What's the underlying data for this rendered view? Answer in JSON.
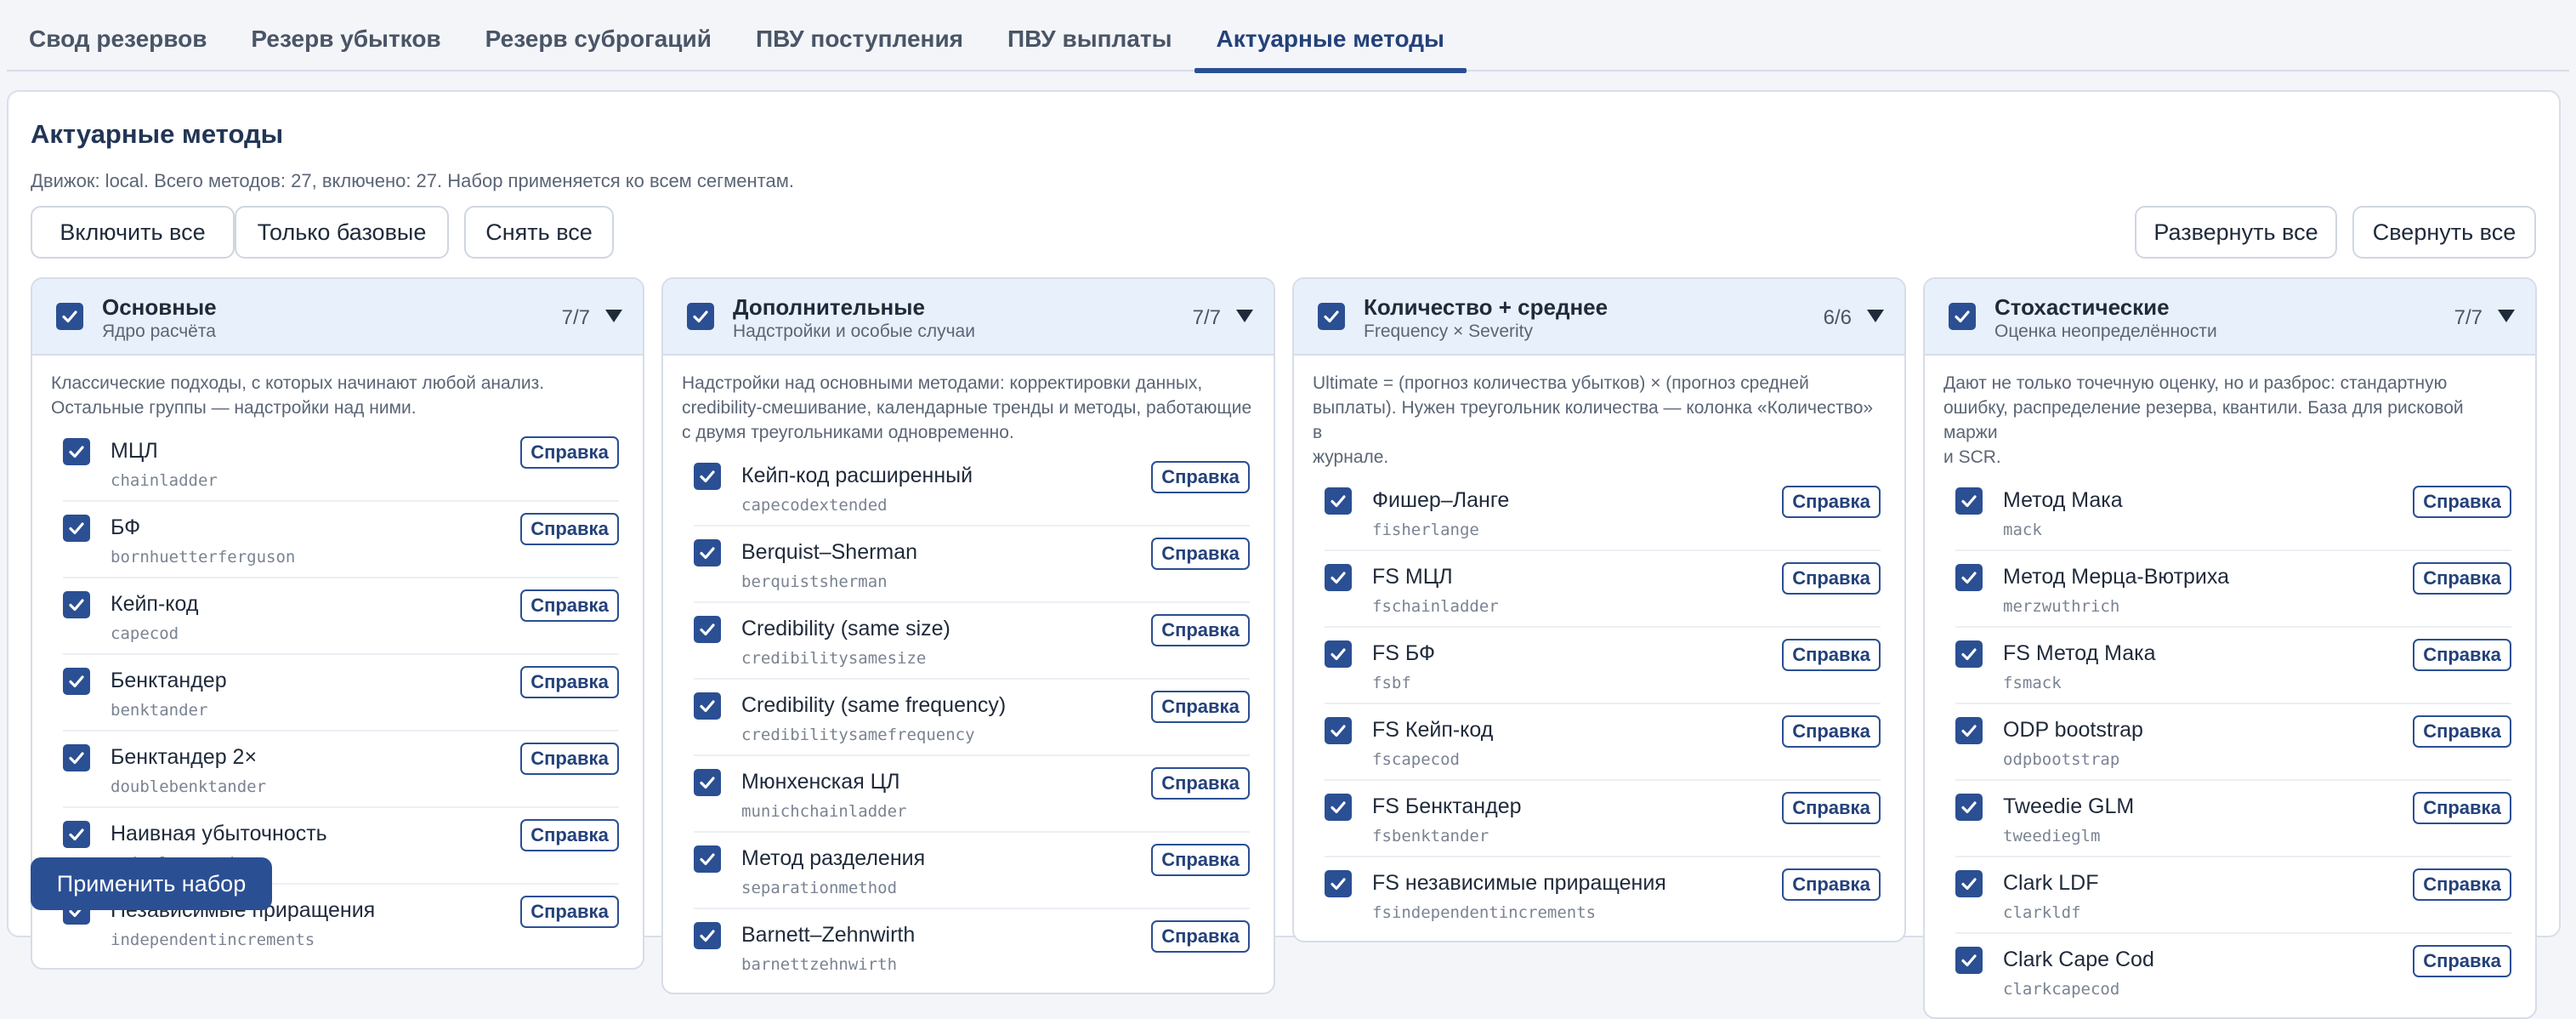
{
  "tabs": [
    "Свод резервов",
    "Резерв убытков",
    "Резерв суброгаций",
    "ПВУ поступления",
    "ПВУ выплаты",
    "Актуарные методы"
  ],
  "active_tab_index": 5,
  "page": {
    "title": "Актуарные методы",
    "subtitle": "Движок: local. Всего методов: 27, включено: 27. Набор применяется ко всем сегментам."
  },
  "toolbar": {
    "enable_all": "Включить все",
    "base_only": "Только базовые",
    "clear_all": "Снять все",
    "expand_all": "Развернуть все",
    "collapse_all": "Свернуть все"
  },
  "apply_label": "Применить набор",
  "help_label": "Справка",
  "groups": [
    {
      "title": "Основные",
      "subtitle": "Ядро расчёта",
      "count": "7/7",
      "description": [
        "Классические подходы, с которых начинают любой анализ.",
        "Остальные группы — надстройки над ними."
      ],
      "methods": [
        {
          "name": "МЦЛ",
          "code": "chainladder",
          "checked": true
        },
        {
          "name": "БФ",
          "code": "bornhuetterferguson",
          "checked": true
        },
        {
          "name": "Кейп-код",
          "code": "capecod",
          "checked": true
        },
        {
          "name": "Бенктандер",
          "code": "benktander",
          "checked": true
        },
        {
          "name": "Бенктандер 2×",
          "code": "doublebenktander",
          "checked": true
        },
        {
          "name": "Наивная убыточность",
          "code": "naivelossratio",
          "checked": true
        },
        {
          "name": "Независимые приращения",
          "code": "independentincrements",
          "checked": true
        }
      ]
    },
    {
      "title": "Дополнительные",
      "subtitle": "Надстройки и особые случаи",
      "count": "7/7",
      "description": [
        "Надстройки над основными методами: корректировки данных,",
        "credibility-смешивание, календарные тренды и методы, работающие",
        "с двумя треугольниками одновременно."
      ],
      "methods": [
        {
          "name": "Кейп-код расширенный",
          "code": "capecodextended",
          "checked": true
        },
        {
          "name": "Berquist–Sherman",
          "code": "berquistsherman",
          "checked": true
        },
        {
          "name": "Credibility (same size)",
          "code": "credibilitysamesize",
          "checked": true
        },
        {
          "name": "Credibility (same frequency)",
          "code": "credibilitysamefrequency",
          "checked": true
        },
        {
          "name": "Мюнхенская ЦЛ",
          "code": "munichchainladder",
          "checked": true
        },
        {
          "name": "Метод разделения",
          "code": "separationmethod",
          "checked": true
        },
        {
          "name": "Barnett–Zehnwirth",
          "code": "barnettzehnwirth",
          "checked": true
        }
      ]
    },
    {
      "title": "Количество + среднее",
      "subtitle": "Frequency × Severity",
      "count": "6/6",
      "description": [
        "Ultimate = (прогноз количества убытков) × (прогноз средней",
        "выплаты). Нужен треугольник количества — колонка «Количество» в",
        "журнале."
      ],
      "methods": [
        {
          "name": "Фишер–Ланге",
          "code": "fisherlange",
          "checked": true
        },
        {
          "name": "FS МЦЛ",
          "code": "fschainladder",
          "checked": true
        },
        {
          "name": "FS БФ",
          "code": "fsbf",
          "checked": true
        },
        {
          "name": "FS Кейп-код",
          "code": "fscapecod",
          "checked": true
        },
        {
          "name": "FS Бенктандер",
          "code": "fsbenktander",
          "checked": true
        },
        {
          "name": "FS независимые приращения",
          "code": "fsindependentincrements",
          "checked": true
        }
      ]
    },
    {
      "title": "Стохастические",
      "subtitle": "Оценка неопределённости",
      "count": "7/7",
      "description": [
        "Дают не только точечную оценку, но и разброс: стандартную",
        "ошибку, распределение резерва, квантили. База для рисковой маржи",
        "и SCR."
      ],
      "methods": [
        {
          "name": "Метод Мака",
          "code": "mack",
          "checked": true
        },
        {
          "name": "Метод Мерца-Вютриха",
          "code": "merzwuthrich",
          "checked": true
        },
        {
          "name": "FS Метод Мака",
          "code": "fsmack",
          "checked": true
        },
        {
          "name": "ODP bootstrap",
          "code": "odpbootstrap",
          "checked": true
        },
        {
          "name": "Tweedie GLM",
          "code": "tweedieglm",
          "checked": true
        },
        {
          "name": "Clark LDF",
          "code": "clarkldf",
          "checked": true
        },
        {
          "name": "Clark Cape Cod",
          "code": "clarkcapecod",
          "checked": true
        }
      ]
    }
  ],
  "colors": {
    "accent": "#2b4f93",
    "header_bg": "#e8f0fb"
  }
}
